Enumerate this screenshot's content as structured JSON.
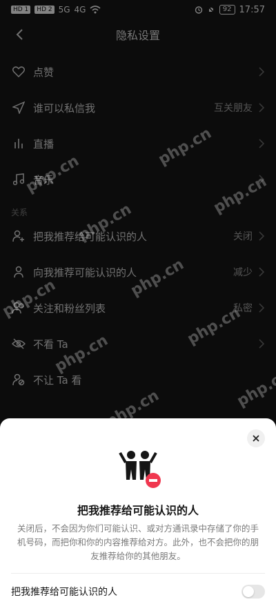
{
  "status_bar": {
    "left_chips": [
      "HD 1",
      "HD 2"
    ],
    "signal_left": "5G",
    "signal_right": "4G",
    "battery": "92",
    "time": "17:57"
  },
  "header": {
    "title": "隐私设置"
  },
  "rows_top": [
    {
      "label": "点赞",
      "value": "",
      "icon": "heart-icon"
    },
    {
      "label": "谁可以私信我",
      "value": "互关朋友",
      "icon": "send-icon"
    },
    {
      "label": "直播",
      "value": "",
      "icon": "live-bars-icon"
    },
    {
      "label": "音乐",
      "value": "",
      "icon": "music-icon"
    }
  ],
  "section_relations": "关系",
  "rows_relations": [
    {
      "label": "把我推荐给可能认识的人",
      "value": "关闭",
      "icon": "user-plus-icon"
    },
    {
      "label": "向我推荐可能认识的人",
      "value": "减少",
      "icon": "user-share-icon"
    },
    {
      "label": "关注和粉丝列表",
      "value": "私密",
      "icon": "users-icon"
    },
    {
      "label": "不看 Ta",
      "value": "",
      "icon": "eye-off-icon"
    },
    {
      "label": "不让 Ta 看",
      "value": "",
      "icon": "user-block-icon"
    }
  ],
  "watermark": "php.cn",
  "sheet": {
    "title": "把我推荐给可能认识的人",
    "description": "关闭后，不会因为你们可能认识、或对方通讯录中存储了你的手机号码，而把你和你的内容推荐给对方。此外，也不会把你的朋友推荐给你的其他朋友。",
    "toggle_label": "把我推荐给可能认识的人",
    "toggle_on": false
  }
}
